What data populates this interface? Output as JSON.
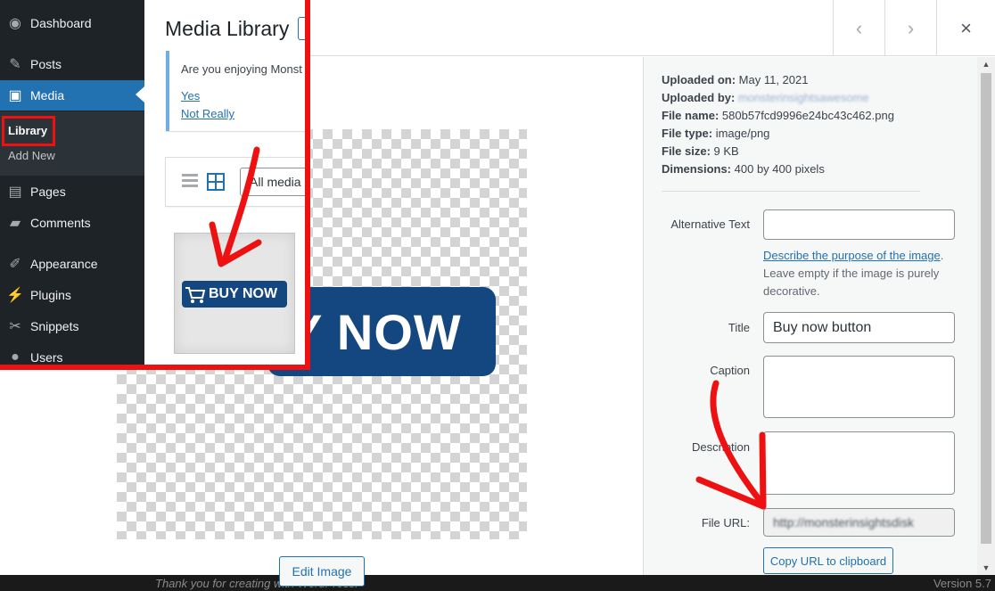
{
  "footer": {
    "left_text": "Thank you for creating with WordPress.",
    "right_text": "Version 5.7"
  },
  "modal": {
    "nav": {
      "prev_glyph": "‹",
      "next_glyph": "›",
      "close_glyph": "×"
    },
    "image": {
      "button_text": "Y NOW"
    },
    "edit_image_label": "Edit Image"
  },
  "details": {
    "uploaded_on_label": "Uploaded on:",
    "uploaded_on": "May 11, 2021",
    "uploaded_by_label": "Uploaded by:",
    "uploaded_by": "monsterinsightsawesome",
    "file_name_label": "File name:",
    "file_name": "580b57fcd9996e24bc43c462.png",
    "file_type_label": "File type:",
    "file_type": "image/png",
    "file_size_label": "File size:",
    "file_size": "9 KB",
    "dimensions_label": "Dimensions:",
    "dimensions": "400 by 400 pixels",
    "alt_text_label": "Alternative Text",
    "alt_text_value": "",
    "alt_help_link": "Describe the purpose of the image",
    "alt_help_period": ".",
    "alt_help_rest": "Leave empty if the image is purely decorative.",
    "title_label": "Title",
    "title_value": "Buy now button",
    "caption_label": "Caption",
    "caption_value": "",
    "description_label": "Description",
    "description_value": "",
    "file_url_label": "File URL:",
    "file_url_value": "http://monsterinsightsdisk",
    "copy_url_label": "Copy URL to clipboard"
  },
  "sidebar": {
    "items": [
      {
        "label": "Dashboard",
        "icon": "dashboard-icon"
      },
      {
        "label": "Posts",
        "icon": "pin-icon"
      },
      {
        "label": "Media",
        "icon": "media-icon"
      },
      {
        "label": "Pages",
        "icon": "pages-icon"
      },
      {
        "label": "Comments",
        "icon": "comment-icon"
      },
      {
        "label": "Appearance",
        "icon": "brush-icon"
      },
      {
        "label": "Plugins",
        "icon": "plugin-icon"
      },
      {
        "label": "Snippets",
        "icon": "scissors-icon"
      },
      {
        "label": "Users",
        "icon": "user-icon"
      }
    ],
    "submenu": {
      "library": "Library",
      "add_new": "Add New"
    }
  },
  "library": {
    "title": "Media Library",
    "notice_text": "Are you enjoying Monst",
    "notice_yes": "Yes",
    "notice_no": "Not Really",
    "filter_value": "All media",
    "thumb_button_text": "BUY NOW"
  },
  "colors": {
    "accent": "#2271b1",
    "annotation_red": "#ee1111",
    "button_navy": "#14477f"
  }
}
